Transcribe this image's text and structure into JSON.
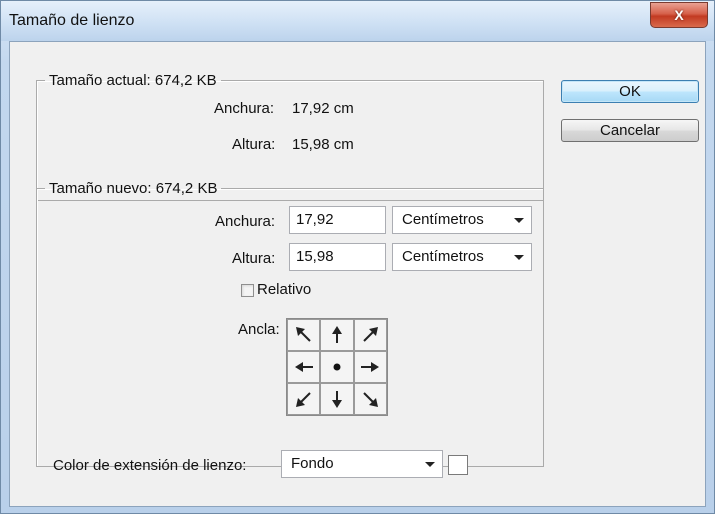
{
  "window": {
    "title": "Tamaño de lienzo",
    "close_label": "X"
  },
  "current_size": {
    "legend": "Tamaño actual: 674,2 KB",
    "width_label": "Anchura:",
    "width_value": "17,92 cm",
    "height_label": "Altura:",
    "height_value": "15,98 cm"
  },
  "new_size": {
    "legend": "Tamaño nuevo: 674,2 KB",
    "width_label": "Anchura:",
    "width_value": "17,92",
    "width_unit": "Centímetros",
    "height_label": "Altura:",
    "height_value": "15,98",
    "height_unit": "Centímetros",
    "relative_label": "Relativo",
    "relative_checked": false,
    "anchor_label": "Ancla:",
    "anchor_selected": "center"
  },
  "buttons": {
    "ok_label": "OK",
    "cancel_label": "Cancelar"
  },
  "extension_color": {
    "label": "Color de extensión de lienzo:",
    "value": "Fondo",
    "swatch_color": "#ffffff"
  }
}
